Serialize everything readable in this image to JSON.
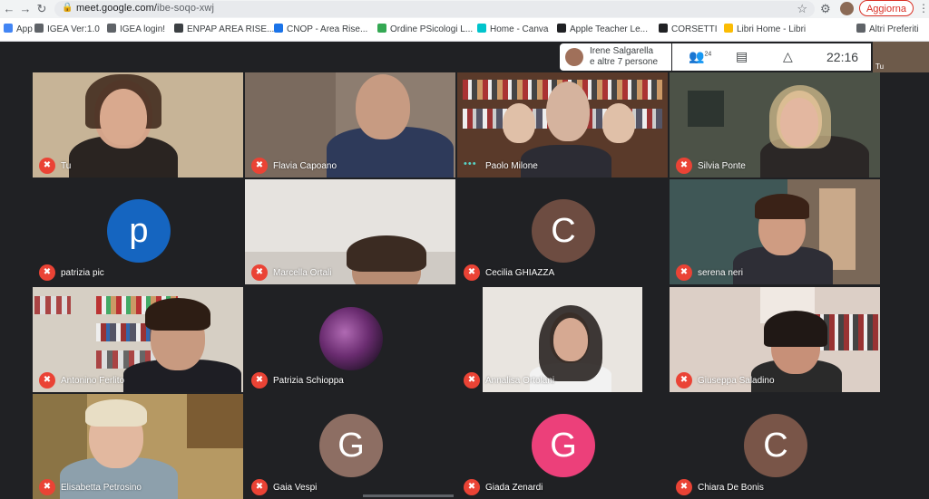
{
  "browser": {
    "url_host": "meet.google.com/",
    "url_path": "ibe-soqo-xwj",
    "update_label": "Aggiorna",
    "nav": {
      "back_icon": "arrow-left-icon",
      "forward_icon": "arrow-right-icon",
      "reload_icon": "reload-icon"
    }
  },
  "bookmarks": [
    {
      "label": "App",
      "color": "#4285f4"
    },
    {
      "label": "IGEA Ver:1.0",
      "color": "#5f6368"
    },
    {
      "label": "IGEA login!",
      "color": "#5f6368"
    },
    {
      "label": "ENPAP AREA RISE...",
      "color": "#3c4043"
    },
    {
      "label": "CNOP - Area Rise...",
      "color": "#1a73e8"
    },
    {
      "label": "Ordine PSicologi L...",
      "color": "#34a853"
    },
    {
      "label": "Home - Canva",
      "color": "#00c4cc"
    },
    {
      "label": "Apple Teacher Le...",
      "color": "#202124"
    },
    {
      "label": "CORSETTI",
      "color": "#202124"
    },
    {
      "label": "Libri Home - Libri",
      "color": "#fbbc04"
    }
  ],
  "bookmarks_other": "Altri Preferiti",
  "meet": {
    "presenter_line1": "Irene Salgarella",
    "presenter_line2": "e altre 7 persone",
    "participants_count": "24",
    "clock": "22:16",
    "self_label": "Tu"
  },
  "participants": [
    {
      "name": "Tu",
      "status": "muted",
      "avatar": null,
      "bg": "#c7b497"
    },
    {
      "name": "Flavia Capoano",
      "status": "muted",
      "avatar": null,
      "bg": "#8d7d70"
    },
    {
      "name": "Paolo Milone",
      "status": "speaking",
      "avatar": null,
      "bg": "#6b4f3a"
    },
    {
      "name": "Silvia Ponte",
      "status": "muted",
      "avatar": null,
      "bg": "#4a4f45"
    },
    {
      "name": "patrizia pic",
      "status": "muted",
      "avatar": "p",
      "avatar_color": "#1565c0",
      "bg": "#202124"
    },
    {
      "name": "Marcella Ortali",
      "status": "muted",
      "avatar": null,
      "bg": "#d8d5d2"
    },
    {
      "name": "Cecilia GHIAZZA",
      "status": "muted",
      "avatar": "C",
      "avatar_color": "#6d4c41",
      "bg": "#202124"
    },
    {
      "name": "serena neri",
      "status": "muted",
      "avatar": null,
      "bg": "#8f7c6a"
    },
    {
      "name": "Antonino Ferlito",
      "status": "muted",
      "avatar": null,
      "bg": "#c9c3b8"
    },
    {
      "name": "Patrizia Schioppa",
      "status": "muted",
      "avatar": null,
      "bg": "#202124"
    },
    {
      "name": "Annalisa Ortolani",
      "status": "muted",
      "avatar": null,
      "bg": "#e8e4df"
    },
    {
      "name": "Giuseppa Saladino",
      "status": "muted",
      "avatar": null,
      "bg": "#d3c6bd"
    },
    {
      "name": "Elisabetta Petrosino",
      "status": "muted",
      "avatar": null,
      "bg": "#a78a52"
    },
    {
      "name": "Gaia Vespi",
      "status": "muted",
      "avatar": "G",
      "avatar_color": "#8d6e63",
      "bg": "#202124"
    },
    {
      "name": "Giada Zenardi",
      "status": "muted",
      "avatar": "G",
      "avatar_color": "#ec407a",
      "bg": "#202124"
    },
    {
      "name": "Chiara De Bonis",
      "status": "muted",
      "avatar": "C",
      "avatar_color": "#795548",
      "bg": "#202124"
    }
  ]
}
